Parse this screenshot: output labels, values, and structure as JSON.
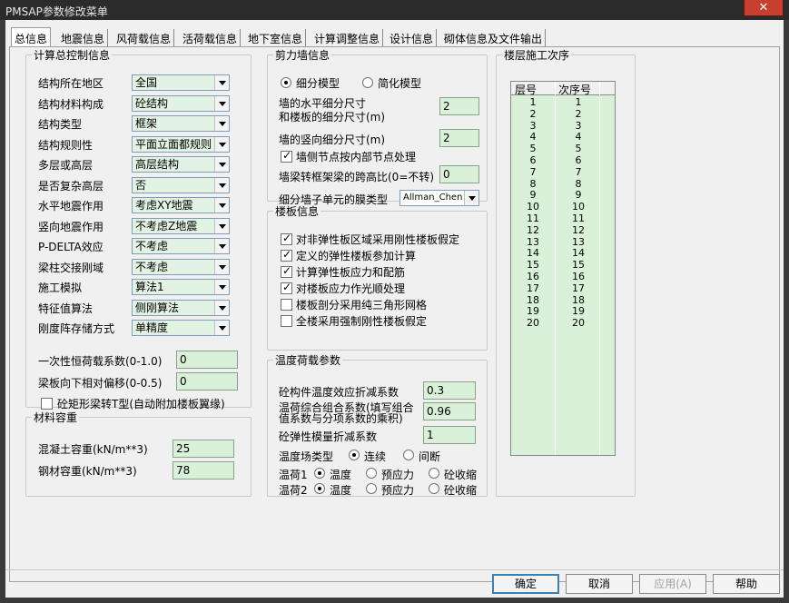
{
  "window": {
    "title": "PMSAP参数修改菜单",
    "close_label": "✕"
  },
  "tabs": [
    "总信息",
    "地震信息",
    "风荷载信息",
    "活荷载信息",
    "地下室信息",
    "计算调整信息",
    "设计信息",
    "砌体信息及文件输出"
  ],
  "general_control": {
    "legend": "计算总控制信息",
    "rows": [
      {
        "label": "结构所在地区",
        "value": "全国"
      },
      {
        "label": "结构材料构成",
        "value": "砼结构"
      },
      {
        "label": "结构类型",
        "value": "框架"
      },
      {
        "label": "结构规则性",
        "value": "平面立面都规则"
      },
      {
        "label": "多层或高层",
        "value": "高层结构"
      },
      {
        "label": "是否复杂高层",
        "value": "否"
      },
      {
        "label": "水平地震作用",
        "value": "考虑XY地震"
      },
      {
        "label": "竖向地震作用",
        "value": "不考虑Z地震"
      },
      {
        "label": "P-DELTA效应",
        "value": "不考虑"
      },
      {
        "label": "梁柱交接刚域",
        "value": "不考虑"
      },
      {
        "label": "施工模拟",
        "value": "算法1"
      },
      {
        "label": "特征值算法",
        "value": "侧刚算法"
      },
      {
        "label": "刚度阵存储方式",
        "value": "单精度"
      }
    ],
    "live_load_factor_label": "一次性恒荷载系数(0-1.0)",
    "live_load_factor_value": "0",
    "slab_offset_label": "梁板向下相对偏移(0-0.5)",
    "slab_offset_value": "0",
    "tbeam_label": "砼矩形梁转T型(自动附加楼板翼缘)",
    "tbeam_checked": false
  },
  "material": {
    "legend": "材料容重",
    "concrete_label": "混凝土容重(kN/m**3)",
    "concrete_value": "25",
    "steel_label": "钢材容重(kN/m**3)",
    "steel_value": "78"
  },
  "shear_wall": {
    "legend": "剪力墙信息",
    "model_fine": "细分模型",
    "model_simple": "简化模型",
    "selected": "fine",
    "h_size_label_1": "墙的水平细分尺寸",
    "h_size_label_2": "和楼板的细分尺寸(m)",
    "h_size_value": "2",
    "v_size_label": "墙的竖向细分尺寸(m)",
    "v_size_value": "2",
    "node_label": "墙侧节点按内部节点处理",
    "node_checked": true,
    "span_ratio_label": "墙梁转框架梁的跨高比(0=不转)",
    "span_ratio_value": "0",
    "membrane_label": "细分墙子单元的膜类型",
    "membrane_value": "Allman_Chen"
  },
  "slab": {
    "legend": "楼板信息",
    "items": [
      {
        "label": "对非弹性板区域采用刚性楼板假定",
        "checked": true
      },
      {
        "label": "定义的弹性楼板参加计算",
        "checked": true
      },
      {
        "label": "计算弹性板应力和配筋",
        "checked": true
      },
      {
        "label": "对楼板应力作光顺处理",
        "checked": true
      },
      {
        "label": "楼板剖分采用纯三角形网格",
        "checked": false
      },
      {
        "label": "全楼采用强制刚性楼板假定",
        "checked": false
      }
    ]
  },
  "temperature": {
    "legend": "温度荷载参数",
    "reduction_label": "砼构件温度效应折减系数",
    "reduction_value": "0.3",
    "combo_label_1": "温荷综合组合系数(填写组合",
    "combo_label_2": "值系数与分项系数的乘积)",
    "combo_value": "0.96",
    "modulus_label": "砼弹性模量折减系数",
    "modulus_value": "1",
    "field_type_label": "温度场类型",
    "field_continuous": "连续",
    "field_discontinuous": "间断",
    "load1_label": "温荷1",
    "load2_label": "温荷2",
    "opt_temp": "温度",
    "opt_prestress": "预应力",
    "opt_shrink": "砼收缩"
  },
  "construction_order": {
    "legend": "楼层施工次序",
    "col_floor": "层号",
    "col_order": "次序号",
    "rows": [
      [
        "1",
        "1"
      ],
      [
        "2",
        "2"
      ],
      [
        "3",
        "3"
      ],
      [
        "4",
        "4"
      ],
      [
        "5",
        "5"
      ],
      [
        "6",
        "6"
      ],
      [
        "7",
        "7"
      ],
      [
        "8",
        "8"
      ],
      [
        "9",
        "9"
      ],
      [
        "10",
        "10"
      ],
      [
        "11",
        "11"
      ],
      [
        "12",
        "12"
      ],
      [
        "13",
        "13"
      ],
      [
        "14",
        "14"
      ],
      [
        "15",
        "15"
      ],
      [
        "16",
        "16"
      ],
      [
        "17",
        "17"
      ],
      [
        "18",
        "18"
      ],
      [
        "19",
        "19"
      ],
      [
        "20",
        "20"
      ]
    ]
  },
  "buttons": {
    "ok": "确定",
    "cancel": "取消",
    "apply": "应用(A)",
    "help": "帮助"
  }
}
